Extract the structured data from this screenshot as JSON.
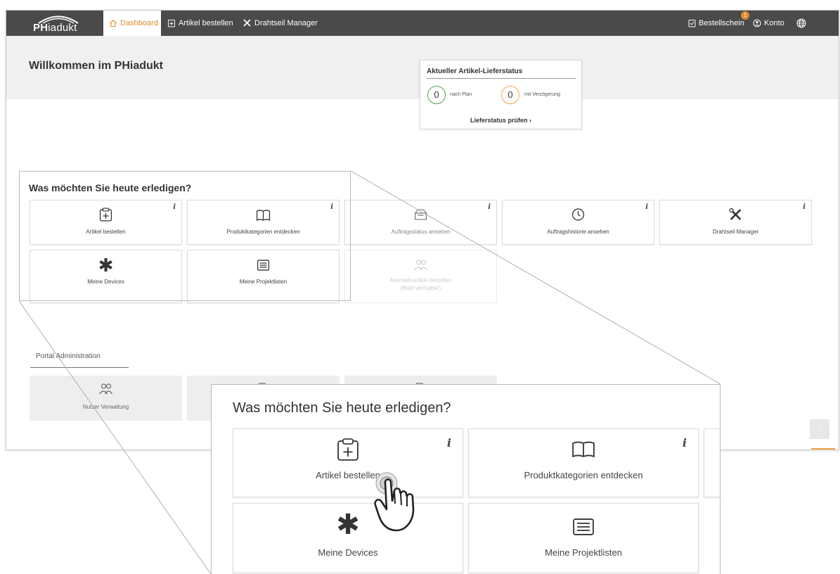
{
  "nav": {
    "logo": {
      "bold": "PH",
      "light": "iadukt"
    },
    "tabs": [
      {
        "label": "Dashboard",
        "icon": "home-icon",
        "active": true
      },
      {
        "label": "Artikel bestellen",
        "icon": "order-icon"
      },
      {
        "label": "Drahtseil Manager",
        "icon": "tools-icon"
      }
    ],
    "bestellschein": "Bestellschein",
    "bestellschein_badge": "1",
    "konto": "Konto",
    "globe_icon": "globe-icon"
  },
  "welcome": "Willkommen im PHiadukt",
  "status": {
    "title": "Aktueller Artikel-Lieferstatus",
    "on_plan_count": "0",
    "on_plan_label": "nach Plan",
    "delayed_count": "0",
    "delayed_label": "mit Verzögerung",
    "check_link": "Lieferstatus prüfen ›",
    "colors": {
      "on_plan": "#5a9e5a",
      "delayed": "#f0a64a"
    }
  },
  "tasks": {
    "title": "Was möchten Sie heute erledigen?",
    "info_symbol": "i",
    "tiles": [
      {
        "label": "Artikel bestellen",
        "icon": "clipboard-plus-icon"
      },
      {
        "label": "Produktkategorien entdecken",
        "icon": "book-icon"
      },
      {
        "label": "Auftragsstatus ansehen",
        "icon": "box-icon"
      },
      {
        "label": "Auftragshistorie ansehen",
        "icon": "clock-icon"
      },
      {
        "label": "Drahtseil Manager",
        "icon": "tools-icon"
      },
      {
        "label": "Meine Devices",
        "icon": "asterisk-icon"
      },
      {
        "label": "Meine Projektlisten",
        "icon": "list-icon"
      },
      {
        "label": "Alternativartikel bestellen",
        "label2": "(Bald verfügbar)",
        "icon": "users-icon",
        "disabled": true
      }
    ]
  },
  "admin": {
    "tab": "Portal Administration",
    "tiles": [
      {
        "label": "Nutzer Verwaltung",
        "icon": "users-icon"
      },
      {
        "label": "",
        "icon": "document-icon"
      },
      {
        "label": "",
        "icon": "document-icon"
      }
    ]
  },
  "scroll_top_icon": "arrow-up-icon",
  "accent_color": "#e08a2c"
}
